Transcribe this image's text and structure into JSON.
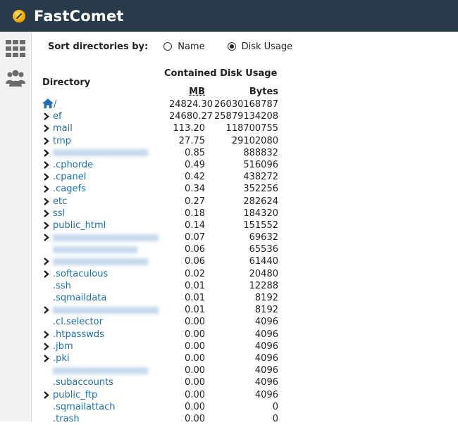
{
  "brand": {
    "name": "FastComet"
  },
  "sidebar": {
    "icons": [
      "grid-icon",
      "users-icon"
    ]
  },
  "sort": {
    "label": "Sort directories by:",
    "options": [
      {
        "label": "Name",
        "checked": false
      },
      {
        "label": "Disk Usage",
        "checked": true
      }
    ]
  },
  "table": {
    "directory_header": "Directory",
    "contained_header": "Contained Disk Usage",
    "mb_header": "MB",
    "bytes_header": "Bytes",
    "rows": [
      {
        "name": "/",
        "mb": "24824.30",
        "bytes": "26030168787",
        "chevron": false,
        "home": true
      },
      {
        "name": "ef",
        "mb": "24680.27",
        "bytes": "25879134208",
        "chevron": true
      },
      {
        "name": "mail",
        "mb": "113.20",
        "bytes": "118700755",
        "chevron": true
      },
      {
        "name": "tmp",
        "mb": "27.75",
        "bytes": "29102080",
        "chevron": true
      },
      {
        "name": "",
        "mb": "0.85",
        "bytes": "888832",
        "chevron": true,
        "blurred": true
      },
      {
        "name": ".cphorde",
        "mb": "0.49",
        "bytes": "516096",
        "chevron": true
      },
      {
        "name": ".cpanel",
        "mb": "0.42",
        "bytes": "438272",
        "chevron": true
      },
      {
        "name": ".cagefs",
        "mb": "0.34",
        "bytes": "352256",
        "chevron": true
      },
      {
        "name": "etc",
        "mb": "0.27",
        "bytes": "282624",
        "chevron": true
      },
      {
        "name": "ssl",
        "mb": "0.18",
        "bytes": "184320",
        "chevron": true
      },
      {
        "name": "public_html",
        "mb": "0.14",
        "bytes": "151552",
        "chevron": true
      },
      {
        "name": "",
        "mb": "0.07",
        "bytes": "69632",
        "chevron": true,
        "blurred": true
      },
      {
        "name": "",
        "mb": "0.06",
        "bytes": "65536",
        "chevron": false,
        "blurred": true
      },
      {
        "name": "",
        "mb": "0.06",
        "bytes": "61440",
        "chevron": true,
        "blurred": true
      },
      {
        "name": ".softaculous",
        "mb": "0.02",
        "bytes": "20480",
        "chevron": true
      },
      {
        "name": ".ssh",
        "mb": "0.01",
        "bytes": "12288",
        "chevron": false
      },
      {
        "name": ".sqmaildata",
        "mb": "0.01",
        "bytes": "8192",
        "chevron": false
      },
      {
        "name": "",
        "mb": "0.01",
        "bytes": "8192",
        "chevron": true,
        "blurred": true
      },
      {
        "name": ".cl.selector",
        "mb": "0.00",
        "bytes": "4096",
        "chevron": false
      },
      {
        "name": ".htpasswds",
        "mb": "0.00",
        "bytes": "4096",
        "chevron": true
      },
      {
        "name": ".jbm",
        "mb": "0.00",
        "bytes": "4096",
        "chevron": true
      },
      {
        "name": ".pki",
        "mb": "0.00",
        "bytes": "4096",
        "chevron": true
      },
      {
        "name": "",
        "mb": "0.00",
        "bytes": "4096",
        "chevron": false,
        "blurred": true
      },
      {
        "name": ".subaccounts",
        "mb": "0.00",
        "bytes": "4096",
        "chevron": false
      },
      {
        "name": "public_ftp",
        "mb": "0.00",
        "bytes": "4096",
        "chevron": true
      },
      {
        "name": ".sqmailattach",
        "mb": "0.00",
        "bytes": "0",
        "chevron": false
      },
      {
        "name": ".trash",
        "mb": "0.00",
        "bytes": "0",
        "chevron": false
      }
    ]
  }
}
